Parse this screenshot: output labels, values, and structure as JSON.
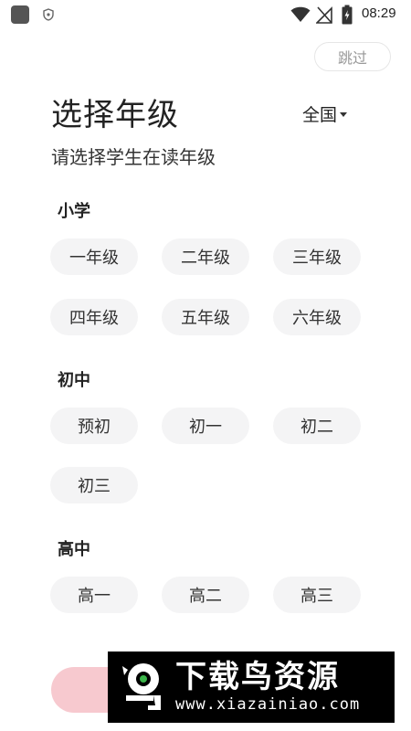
{
  "status_bar": {
    "time": "08:29",
    "icons": [
      "app-icon",
      "shield-icon",
      "wifi-icon",
      "no-signal-icon",
      "battery-charging-icon"
    ]
  },
  "skip_label": "跳过",
  "title": "选择年级",
  "region": {
    "label": "全国",
    "icon": "caret-down-icon"
  },
  "subtitle": "请选择学生在读年级",
  "sections": [
    {
      "label": "小学",
      "grades": [
        "一年级",
        "二年级",
        "三年级",
        "四年级",
        "五年级",
        "六年级"
      ]
    },
    {
      "label": "初中",
      "grades": [
        "预初",
        "初一",
        "初二",
        "初三"
      ]
    },
    {
      "label": "高中",
      "grades": [
        "高一",
        "高二",
        "高三"
      ]
    }
  ],
  "watermark": {
    "title": "下载鸟资源",
    "url": "www.xiazainiao.com"
  },
  "colors": {
    "primary_button": "#f7c9cf",
    "chip_bg": "#f4f4f5"
  }
}
